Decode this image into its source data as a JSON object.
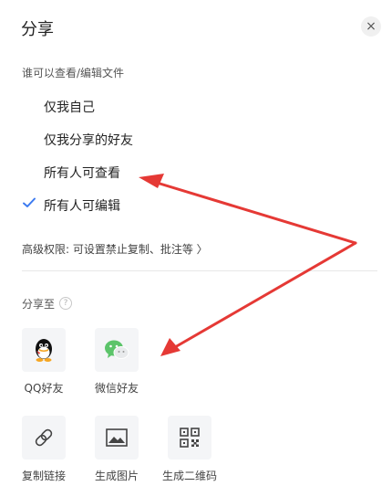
{
  "dialog": {
    "title": "分享",
    "close_glyph": "×"
  },
  "permissions": {
    "label": "谁可以查看/编辑文件",
    "options": [
      "仅我自己",
      "仅我分享的好友",
      "所有人可查看",
      "所有人可编辑"
    ],
    "selected_index": 3
  },
  "advanced": {
    "label": "高级权限: 可设置禁止复制、批注等 〉"
  },
  "share_to": {
    "label": "分享至",
    "help_glyph": "?",
    "targets": [
      {
        "label": "QQ好友",
        "icon": "qq-icon"
      },
      {
        "label": "微信好友",
        "icon": "wechat-icon"
      },
      {
        "label": "复制链接",
        "icon": "link-icon"
      },
      {
        "label": "生成图片",
        "icon": "image-icon"
      },
      {
        "label": "生成二维码",
        "icon": "qrcode-icon"
      }
    ]
  },
  "colors": {
    "accent": "#3b7af0",
    "annotation_arrow": "#e53935",
    "tile_bg": "#f4f5f7"
  }
}
